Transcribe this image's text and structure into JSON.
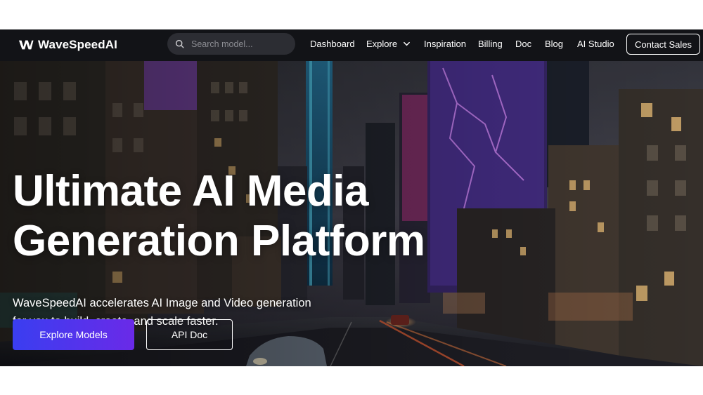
{
  "brand": {
    "name": "WaveSpeedAI",
    "logo_icon": "wave-logo-icon"
  },
  "search": {
    "placeholder": "Search model...",
    "icon": "search-icon"
  },
  "nav": {
    "dashboard": "Dashboard",
    "explore": "Explore",
    "inspiration": "Inspiration",
    "billing": "Billing",
    "doc": "Doc",
    "blog": "Blog",
    "ai_studio": "AI Studio",
    "contact_sales": "Contact Sales"
  },
  "hero": {
    "title_line1": "Ultimate AI Media",
    "title_line2": "Generation Platform",
    "subtitle_line1": "WaveSpeedAI accelerates AI Image and Video generation",
    "subtitle_line2": "for you to build, create, and scale faster.",
    "primary_button": "Explore Models",
    "secondary_button": "API Doc"
  },
  "colors": {
    "navbar_bg": "#121317",
    "primary_gradient_start": "#3a3ef0",
    "primary_gradient_end": "#6a2ae8",
    "neon_purple": "#b04cff",
    "neon_cyan": "#3fd6ff"
  }
}
